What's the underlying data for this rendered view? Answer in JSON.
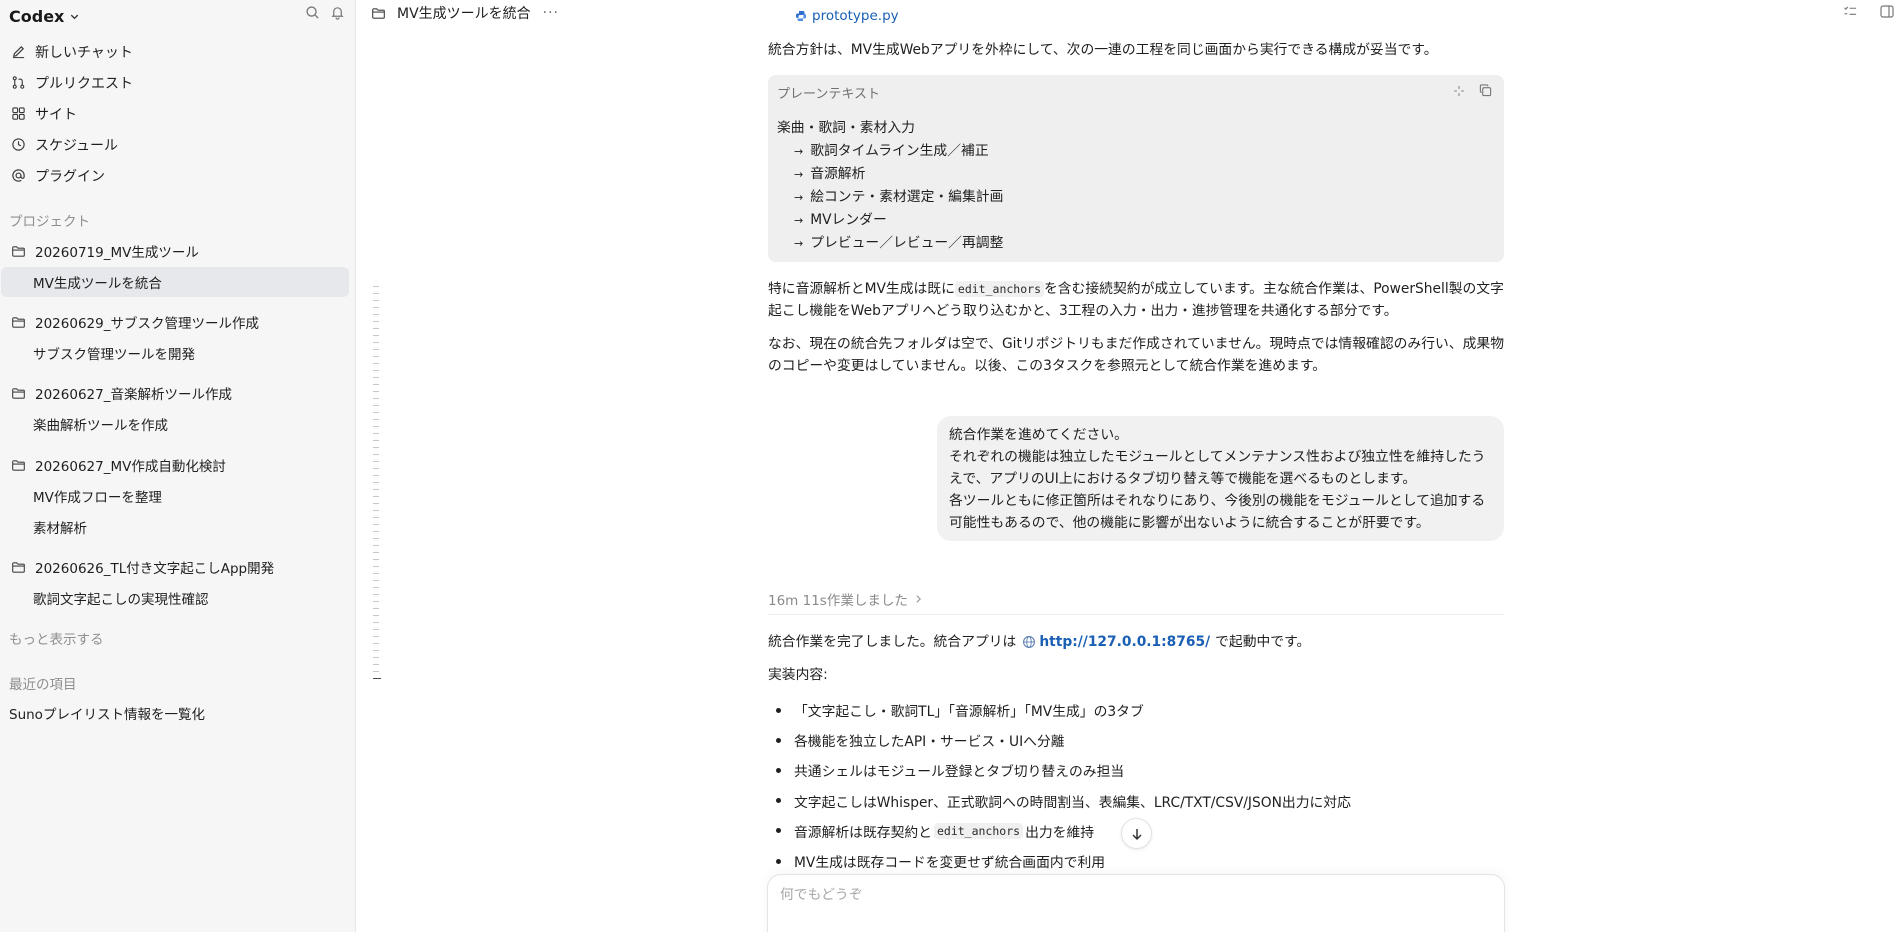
{
  "app": {
    "name": "Codex"
  },
  "sidebar": {
    "nav": [
      {
        "label": "新しいチャット",
        "icon": "edit-icon"
      },
      {
        "label": "プルリクエスト",
        "icon": "pull-request-icon"
      },
      {
        "label": "サイト",
        "icon": "site-grid-icon"
      },
      {
        "label": "スケジュール",
        "icon": "clock-icon"
      },
      {
        "label": "プラグイン",
        "icon": "at-icon"
      }
    ],
    "projects_label": "プロジェクト",
    "projects": [
      {
        "name": "20260719_MV生成ツール",
        "threads": [
          "MV生成ツールを統合"
        ]
      },
      {
        "name": "20260629_サブスク管理ツール作成",
        "threads": [
          "サブスク管理ツールを開発"
        ]
      },
      {
        "name": "20260627_音楽解析ツール作成",
        "threads": [
          "楽曲解析ツールを作成"
        ]
      },
      {
        "name": "20260627_MV作成自動化検討",
        "threads": [
          "MV作成フローを整理",
          "素材解析"
        ]
      },
      {
        "name": "20260626_TL付き文字起こしApp開発",
        "threads": [
          "歌詞文字起こしの実現性確認"
        ]
      }
    ],
    "show_more": "もっと表示する",
    "recent_label": "最近の項目",
    "recent": [
      "Sunoプレイリスト情報を一覧化"
    ]
  },
  "topbar": {
    "title": "MV生成ツールを統合",
    "more": "···"
  },
  "conversation": {
    "file_link": "prototype.py",
    "intro": "統合方針は、MV生成Webアプリを外枠にして、次の一連の工程を同じ画面から実行できる構成が妥当です。",
    "codeblock": {
      "language": "プレーンテキスト",
      "first": "楽曲・歌詞・素材入力",
      "arrow": "→",
      "steps": [
        "歌詞タイムライン生成／補正",
        "音源解析",
        "絵コンテ・素材選定・編集計画",
        "MVレンダー",
        "プレビュー／レビュー／再調整"
      ]
    },
    "para2_a": "特に音源解析とMV生成は既に",
    "para2_code": "edit_anchors",
    "para2_b": "を含む接続契約が成立しています。主な統合作業は、PowerShell製の文字起こし機能をWebアプリへどう取り込むかと、3工程の入力・出力・進捗管理を共通化する部分です。",
    "para3": "なお、現在の統合先フォルダは空で、Gitリポジトリもまだ作成されていません。現時点では情報確認のみ行い、成果物のコピーや変更はしていません。以後、この3タスクを参照元として統合作業を進めます。",
    "user_message": [
      "統合作業を進めてください。",
      "それぞれの機能は独立したモジュールとしてメンテナンス性および独立性を維持したうえで、アプリのUI上におけるタブ切り替え等で機能を選べるものとします。",
      "各ツールともに修正箇所はそれなりにあり、今後別の機能をモジュールとして追加する可能性もあるので、他の機能に影響が出ないように統合することが肝要です。"
    ],
    "worked": "16m 11s作業しました",
    "done_a": "統合作業を完了しました。統合アプリは",
    "done_url": "http://127.0.0.1:8765/",
    "done_b": "で起動中です。",
    "impl_label": "実装内容:",
    "bullets": [
      "「文字起こし・歌詞TL」「音源解析」「MV生成」の3タブ",
      "各機能を独立したAPI・サービス・UIへ分離",
      "共通シェルはモジュール登録とタブ切り替えのみ担当",
      "文字起こしはWhisper、正式歌詞への時間割当、表編集、LRC/TXT/CSV/JSON出力に対応"
    ],
    "bullet5_a": "音源解析は既存契約と",
    "bullet5_code": "edit_anchors",
    "bullet5_b": "出力を維持",
    "bullet6": "MV生成は既存コードを変更せず統合画面内で利用"
  },
  "composer": {
    "placeholder": "何でもどうぞ"
  }
}
